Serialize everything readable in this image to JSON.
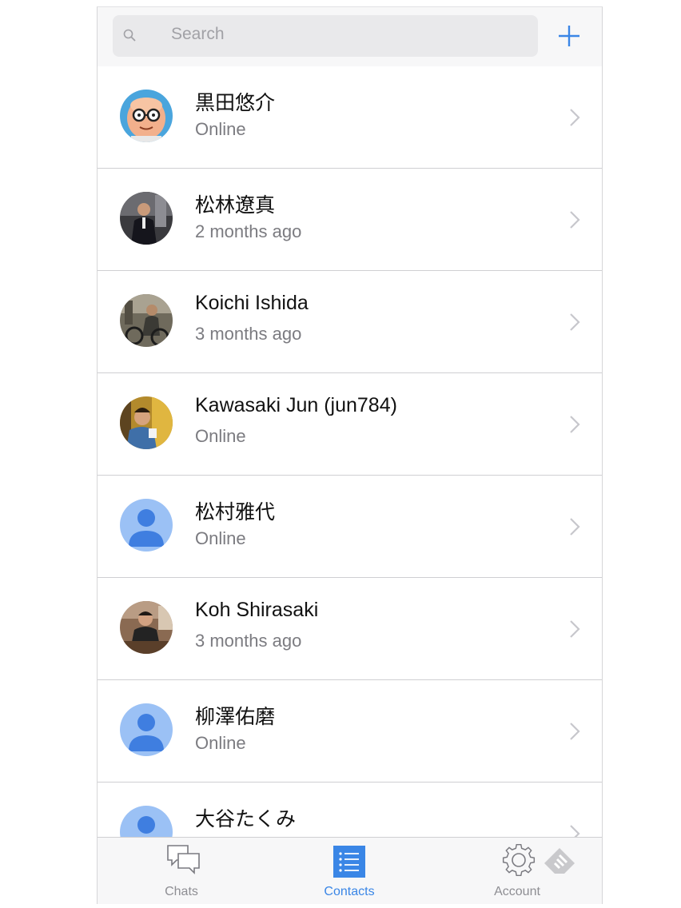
{
  "search": {
    "placeholder": "Search"
  },
  "icons": {
    "search": "search-icon",
    "add": "plus-icon",
    "chevron": "chevron-right-icon"
  },
  "colors": {
    "accent": "#3a86e6",
    "avatar_placeholder": "#9bc1f5",
    "avatar_placeholder_figure": "#3f7ee0"
  },
  "contacts": [
    {
      "name": "黒田悠介",
      "status": "Online",
      "avatar": "photo-bald-glasses"
    },
    {
      "name": "松林遼真",
      "status": "2 months ago",
      "avatar": "photo-suit-man"
    },
    {
      "name": "Koichi Ishida",
      "status": "3 months ago",
      "avatar": "photo-bicycle"
    },
    {
      "name": "Kawasaki Jun (jun784)",
      "status": "Online",
      "avatar": "photo-man-yellow"
    },
    {
      "name": "松村雅代",
      "status": "Online",
      "avatar": "default-user-icon"
    },
    {
      "name": "Koh Shirasaki",
      "status": "3 months ago",
      "avatar": "photo-cafe-man"
    },
    {
      "name": "柳澤佑磨",
      "status": "Online",
      "avatar": "default-user-icon"
    },
    {
      "name": "大谷たくみ",
      "status": "",
      "avatar": "default-user-icon"
    }
  ],
  "tabs": [
    {
      "label": "Chats",
      "icon": "chat-bubbles-icon",
      "active": false
    },
    {
      "label": "Contacts",
      "icon": "contacts-list-icon",
      "active": true
    },
    {
      "label": "Account",
      "icon": "gear-icon",
      "active": false
    }
  ]
}
